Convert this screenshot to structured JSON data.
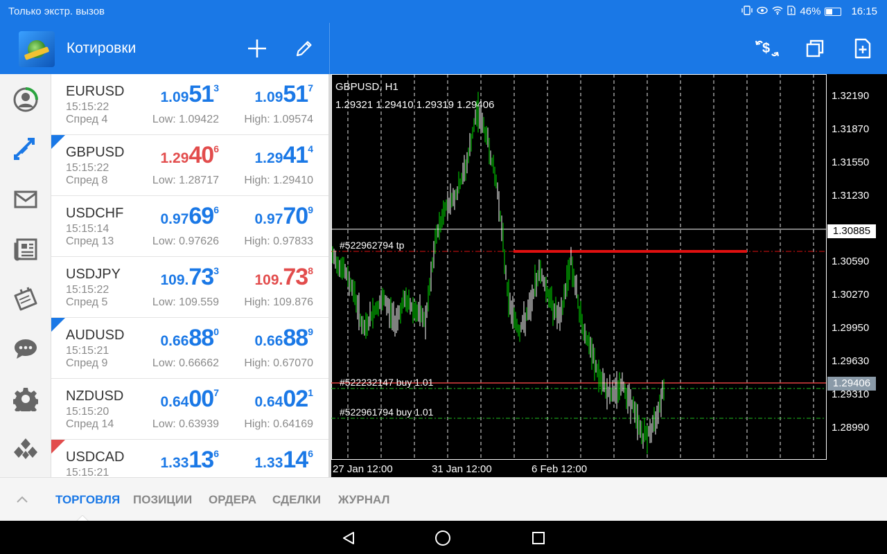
{
  "status_bar": {
    "carrier_text": "Только экстр. вызов",
    "battery": "46%",
    "time": "16:15"
  },
  "app_bar": {
    "title": "Котировки",
    "icons": [
      "add-icon",
      "edit-icon",
      "trade-icon",
      "windows-icon",
      "new-document-icon"
    ]
  },
  "sidebar": {
    "items": [
      "account-icon",
      "trade-arrows-icon",
      "mail-icon",
      "news-icon",
      "calendar-icon",
      "chat-icon",
      "settings-icon",
      "community-icon"
    ]
  },
  "quotes": [
    {
      "symbol": "EURUSD",
      "time": "15:15:22",
      "spread": "Спред 4",
      "marker": "none",
      "bid": {
        "pre": "1.09",
        "big": "51",
        "sup": "3",
        "color": "blue"
      },
      "ask": {
        "pre": "1.09",
        "big": "51",
        "sup": "7",
        "color": "blue"
      },
      "low": "Low: 1.09422",
      "high": "High: 1.09574"
    },
    {
      "symbol": "GBPUSD",
      "time": "15:15:22",
      "spread": "Спред 8",
      "marker": "blue",
      "bid": {
        "pre": "1.29",
        "big": "40",
        "sup": "6",
        "color": "red"
      },
      "ask": {
        "pre": "1.29",
        "big": "41",
        "sup": "4",
        "color": "blue"
      },
      "low": "Low: 1.28717",
      "high": "High: 1.29410"
    },
    {
      "symbol": "USDCHF",
      "time": "15:15:14",
      "spread": "Спред 13",
      "marker": "none",
      "bid": {
        "pre": "0.97",
        "big": "69",
        "sup": "6",
        "color": "blue"
      },
      "ask": {
        "pre": "0.97",
        "big": "70",
        "sup": "9",
        "color": "blue"
      },
      "low": "Low: 0.97626",
      "high": "High: 0.97833"
    },
    {
      "symbol": "USDJPY",
      "time": "15:15:22",
      "spread": "Спред 5",
      "marker": "none",
      "bid": {
        "pre": "109.",
        "big": "73",
        "sup": "3",
        "color": "blue"
      },
      "ask": {
        "pre": "109.",
        "big": "73",
        "sup": "8",
        "color": "red"
      },
      "low": "Low: 109.559",
      "high": "High: 109.876"
    },
    {
      "symbol": "AUDUSD",
      "time": "15:15:21",
      "spread": "Спред 9",
      "marker": "blue",
      "bid": {
        "pre": "0.66",
        "big": "88",
        "sup": "0",
        "color": "blue"
      },
      "ask": {
        "pre": "0.66",
        "big": "88",
        "sup": "9",
        "color": "blue"
      },
      "low": "Low: 0.66662",
      "high": "High: 0.67070"
    },
    {
      "symbol": "NZDUSD",
      "time": "15:15:20",
      "spread": "Спред 14",
      "marker": "none",
      "bid": {
        "pre": "0.64",
        "big": "00",
        "sup": "7",
        "color": "blue"
      },
      "ask": {
        "pre": "0.64",
        "big": "02",
        "sup": "1",
        "color": "blue"
      },
      "low": "Low: 0.63939",
      "high": "High: 0.64169"
    },
    {
      "symbol": "USDCAD",
      "time": "15:15:21",
      "spread": "",
      "marker": "red",
      "bid": {
        "pre": "1.33",
        "big": "13",
        "sup": "6",
        "color": "blue"
      },
      "ask": {
        "pre": "1.33",
        "big": "14",
        "sup": "6",
        "color": "blue"
      },
      "low": "",
      "high": ""
    }
  ],
  "chart": {
    "title": "GBPUSD, H1",
    "ohlc": "1.29321 1.29410 1.29319 1.29406",
    "current_price": "1.30885",
    "bid_price": "1.29406",
    "y_ticks": [
      "1.32190",
      "1.31870",
      "1.31550",
      "1.31230",
      "1.30590",
      "1.30270",
      "1.29950",
      "1.29630",
      "1.29310",
      "1.28990"
    ],
    "x_ticks": [
      "27 Jan 12:00",
      "31 Jan 12:00",
      "6 Feb 12:00"
    ],
    "orders": [
      {
        "label": "#522962794 tp"
      },
      {
        "label": "#522232147 buy 1.01"
      },
      {
        "label": "#522961794 buy 1.01"
      }
    ],
    "colors": {
      "bull": "#ffffff",
      "bear": "#00e000",
      "tp_line": "#e01010",
      "order_line": "#e04040",
      "buy_line": "#20c020"
    }
  },
  "chart_data": {
    "type": "line",
    "title": "GBPUSD, H1",
    "xlabel": "",
    "ylabel": "",
    "ylim": [
      1.287,
      1.3233
    ],
    "x": [
      "27 Jan 12:00",
      "31 Jan 12:00",
      "6 Feb 12:00"
    ],
    "series": [
      {
        "values": [
          1.306,
          1.305,
          1.303,
          1.299,
          1.301,
          1.302,
          1.3,
          1.302,
          1.301,
          1.3,
          1.308,
          1.311,
          1.312,
          1.315,
          1.32,
          1.317,
          1.312,
          1.302,
          1.299,
          1.301,
          1.305,
          1.302,
          1.3,
          1.306,
          1.3,
          1.297,
          1.294,
          1.293,
          1.294,
          1.292,
          1.289,
          1.29,
          1.294
        ]
      }
    ],
    "grid": true
  },
  "tabs": {
    "items": [
      "ТОРГОВЛЯ",
      "ПОЗИЦИИ",
      "ОРДЕРА",
      "СДЕЛКИ",
      "ЖУРНАЛ"
    ],
    "active": "ТОРГОВЛЯ"
  }
}
